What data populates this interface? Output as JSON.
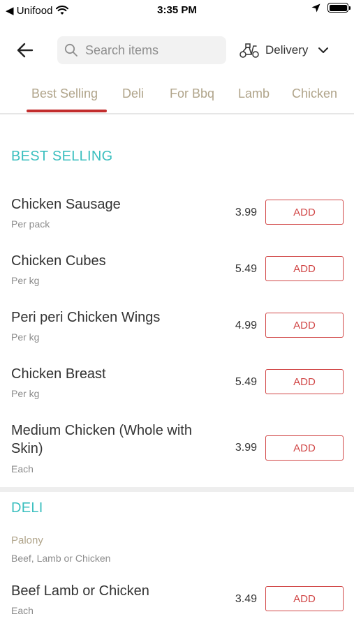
{
  "status_bar": {
    "carrier": "◀ Unifood",
    "time": "3:35 PM"
  },
  "header": {
    "search_placeholder": "Search items",
    "delivery_label": "Delivery"
  },
  "tabs": [
    {
      "label": "Best Selling",
      "active": true
    },
    {
      "label": "Deli",
      "active": false
    },
    {
      "label": "For Bbq",
      "active": false
    },
    {
      "label": "Lamb",
      "active": false
    },
    {
      "label": "Chicken",
      "active": false
    }
  ],
  "sections": [
    {
      "title": "BEST SELLING",
      "items": [
        {
          "name": "Chicken Sausage",
          "unit": "Per pack",
          "price": "3.99",
          "button": "ADD"
        },
        {
          "name": "Chicken Cubes",
          "unit": "Per kg",
          "price": "5.49",
          "button": "ADD"
        },
        {
          "name": "Peri peri Chicken Wings",
          "unit": "Per kg",
          "price": "4.99",
          "button": "ADD"
        },
        {
          "name": "Chicken Breast",
          "unit": "Per kg",
          "price": "5.49",
          "button": "ADD"
        },
        {
          "name": "Medium Chicken (Whole with Skin)",
          "unit": "Each",
          "price": "3.99",
          "button": "ADD"
        }
      ]
    },
    {
      "title": "DELI",
      "subcategory": "Palony",
      "subcategory_desc": "Beef, Lamb or Chicken",
      "items": [
        {
          "name": "Beef Lamb or Chicken",
          "unit": "Each",
          "price": "3.49",
          "button": "ADD"
        }
      ]
    }
  ],
  "colors": {
    "accent_red": "#d14747",
    "section_teal": "#3bbfbf",
    "tab_text": "#b0a48a"
  }
}
